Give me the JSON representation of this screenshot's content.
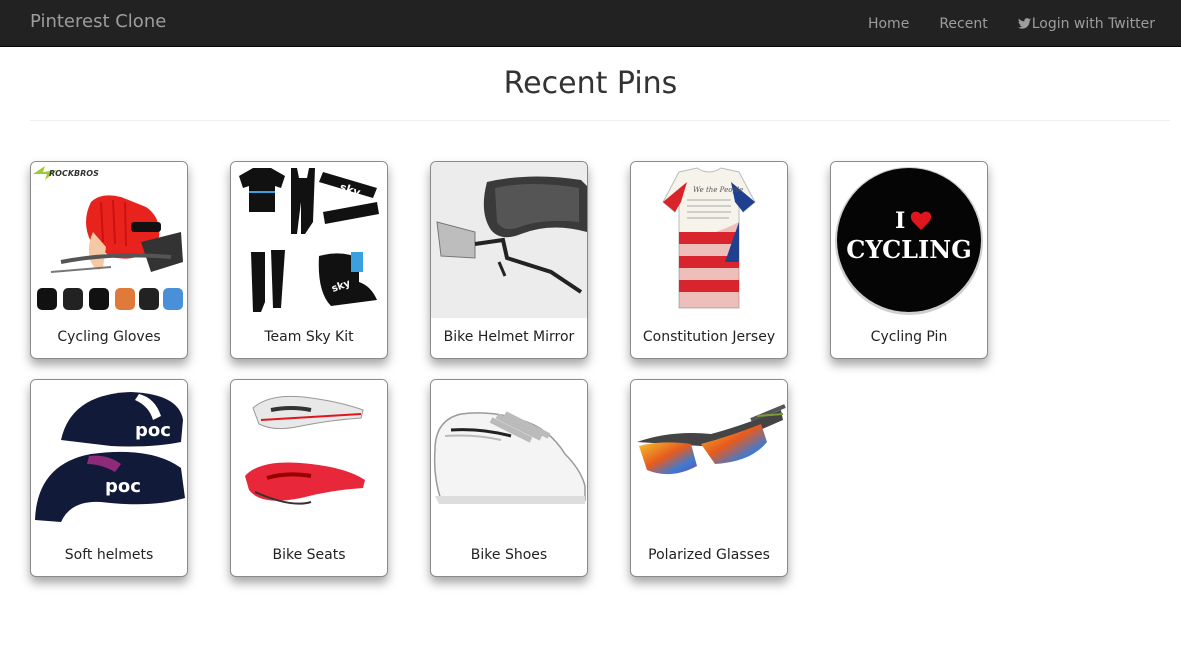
{
  "navbar": {
    "brand": "Pinterest Clone",
    "links": [
      {
        "label": "Home"
      },
      {
        "label": "Recent"
      },
      {
        "label": "Login with Twitter",
        "icon": "twitter-icon"
      }
    ]
  },
  "page": {
    "title": "Recent Pins"
  },
  "pins": [
    {
      "caption": "Cycling Gloves",
      "image_text": "ROCKBROS"
    },
    {
      "caption": "Team Sky Kit",
      "image_text": "sky"
    },
    {
      "caption": "Bike Helmet Mirror"
    },
    {
      "caption": "Constitution Jersey",
      "image_text": "We the People"
    },
    {
      "caption": "Cycling Pin",
      "image_text_line1": "I",
      "image_text_line2": "CYCLING"
    },
    {
      "caption": "Soft helmets",
      "image_text": "poc"
    },
    {
      "caption": "Bike Seats"
    },
    {
      "caption": "Bike Shoes"
    },
    {
      "caption": "Polarized Glasses"
    }
  ],
  "colors": {
    "navbar_bg": "#222222",
    "navbar_text": "#9d9d9d",
    "card_border": "#8a8a8a"
  }
}
